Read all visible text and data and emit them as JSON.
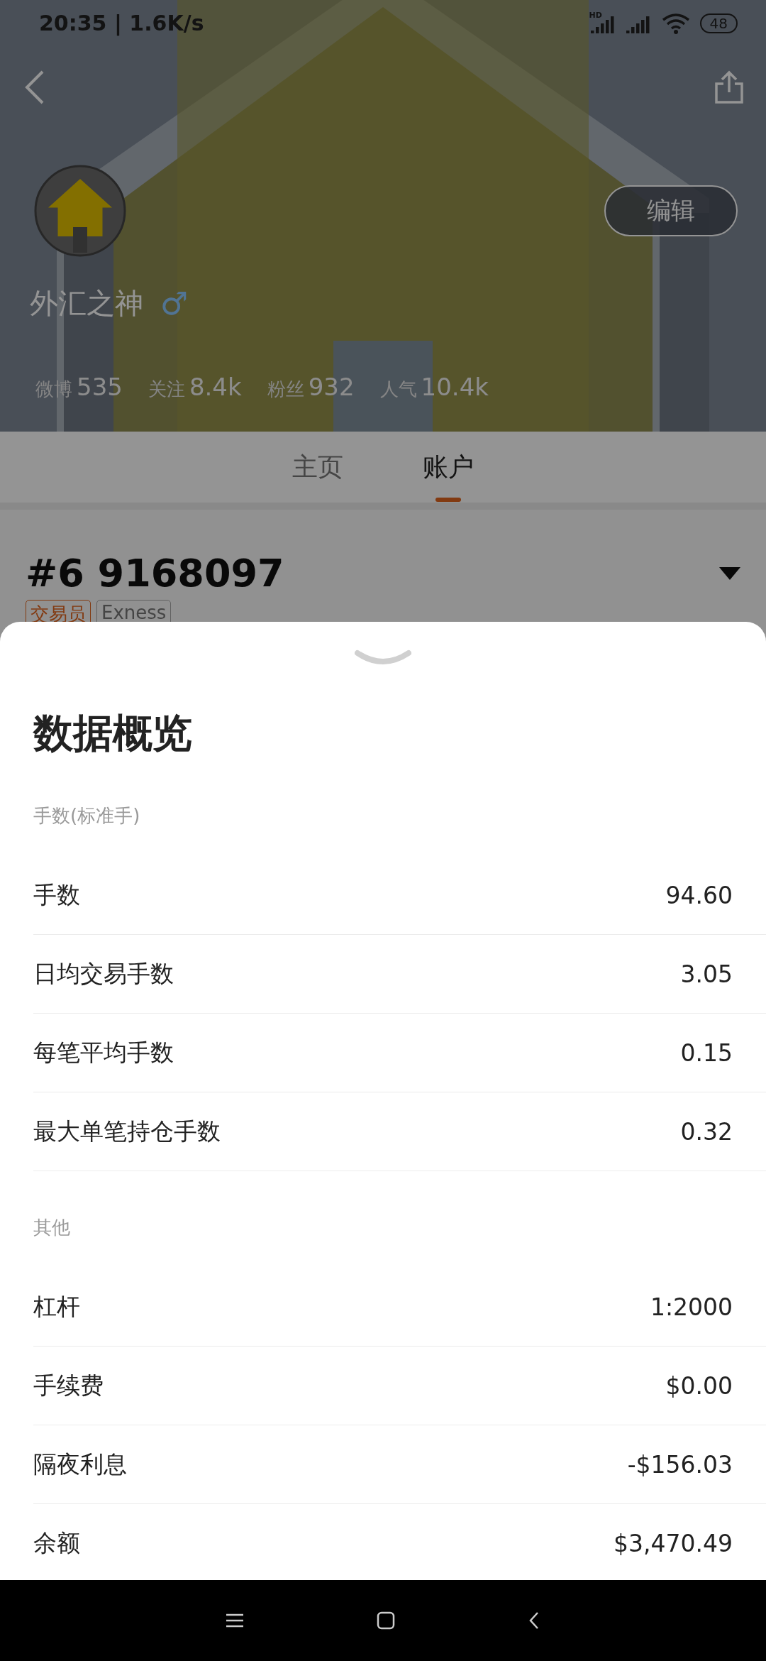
{
  "status_bar": {
    "time": "20:35 | 1.6K/s",
    "network_label": "HD",
    "battery": "48"
  },
  "profile": {
    "name": "外汇之神",
    "gender_symbol": "♂",
    "edit_button": "编辑",
    "stats": [
      {
        "label": "微博",
        "value": "535"
      },
      {
        "label": "关注",
        "value": "8.4k"
      },
      {
        "label": "粉丝",
        "value": "932"
      },
      {
        "label": "人气",
        "value": "10.4k"
      }
    ]
  },
  "tabs": [
    {
      "label": "主页",
      "selected": false
    },
    {
      "label": "账户",
      "selected": true
    }
  ],
  "account": {
    "number": "#6 9168097",
    "tags": [
      {
        "label": "交易员",
        "kind": "role"
      },
      {
        "label": "Exness",
        "kind": "broker"
      }
    ]
  },
  "sheet": {
    "title": "数据概览",
    "sections": [
      {
        "heading": "手数(标准手)",
        "rows": [
          {
            "label": "手数",
            "value": "94.60"
          },
          {
            "label": "日均交易手数",
            "value": "3.05"
          },
          {
            "label": "每笔平均手数",
            "value": "0.15"
          },
          {
            "label": "最大单笔持仓手数",
            "value": "0.32"
          }
        ]
      },
      {
        "heading": "其他",
        "rows": [
          {
            "label": "杠杆",
            "value": "1:2000"
          },
          {
            "label": "手续费",
            "value": "$0.00"
          },
          {
            "label": "隔夜利息",
            "value": "-$156.03"
          },
          {
            "label": "余额",
            "value": "$3,470.49"
          }
        ]
      }
    ]
  }
}
